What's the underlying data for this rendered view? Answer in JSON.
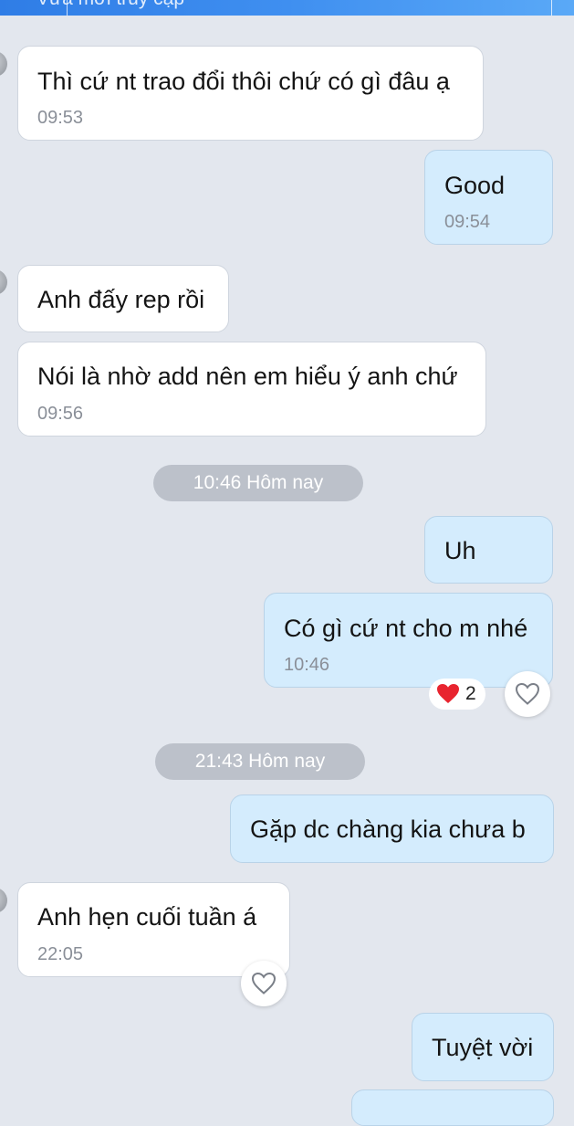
{
  "status_bar": {
    "text": "Vừa mới truy cập"
  },
  "messages": [
    {
      "text": "Thì cứ nt trao đổi thôi chứ có gì đâu ạ",
      "time": "09:53"
    },
    {
      "text": "Good",
      "time": "09:54"
    },
    {
      "text": "Anh đấy rep rồi"
    },
    {
      "text": "Nói là nhờ add nên em hiểu ý anh chứ",
      "time": "09:56"
    },
    {
      "text": "Uh"
    },
    {
      "text": "Có gì cứ nt cho m nhé",
      "time": "10:46"
    },
    {
      "text": "Gặp dc chàng kia chưa b"
    },
    {
      "text": "Anh hẹn cuối tuần á",
      "time": "22:05"
    },
    {
      "text": "Tuyệt vời"
    }
  ],
  "separators": [
    "10:46 Hôm nay",
    "21:43 Hôm nay"
  ],
  "reactions": {
    "heart_count": "2",
    "heart_color": "#e8242f"
  },
  "colors": {
    "background": "#e3e7ee",
    "incoming_bubble": "#ffffff",
    "outgoing_bubble": "#d4ecfd",
    "separator": "#bcc1ca",
    "header_accent": "#3f8ff0"
  }
}
